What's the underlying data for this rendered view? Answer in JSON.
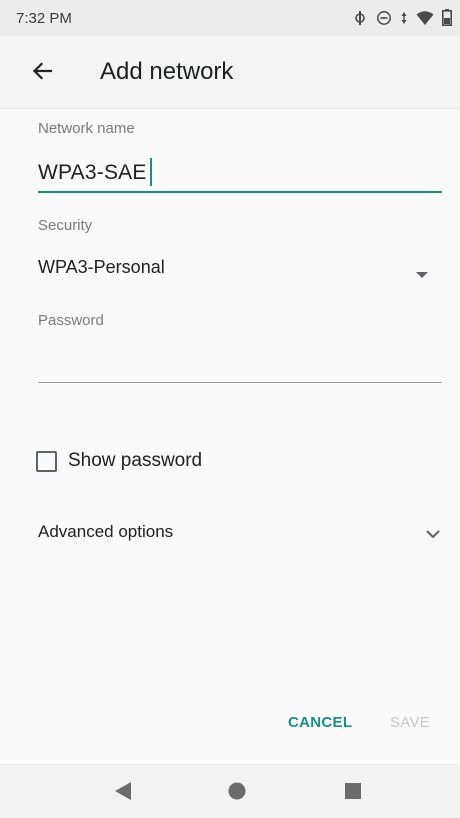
{
  "status_bar": {
    "time": "7:32 PM",
    "icons": [
      "sync-icon",
      "do-not-disturb-icon",
      "data-arrows-icon",
      "wifi-icon",
      "battery-icon"
    ]
  },
  "app_bar": {
    "back_icon": "arrow-back-icon",
    "title": "Add network"
  },
  "form": {
    "network_name": {
      "label": "Network name",
      "value": "WPA3-SAE"
    },
    "security": {
      "label": "Security",
      "value": "WPA3-Personal",
      "icon": "dropdown-arrow-icon"
    },
    "password": {
      "label": "Password",
      "value": ""
    },
    "show_password": {
      "label": "Show password",
      "checked": false
    },
    "advanced": {
      "label": "Advanced options",
      "icon": "chevron-down-icon"
    }
  },
  "actions": {
    "cancel": "CANCEL",
    "save": "SAVE"
  },
  "colors": {
    "accent": "#1a8f88",
    "disabled": "#c8c8c8"
  },
  "nav_bar": {
    "icons": [
      "nav-back-icon",
      "nav-home-icon",
      "nav-recents-icon"
    ]
  }
}
